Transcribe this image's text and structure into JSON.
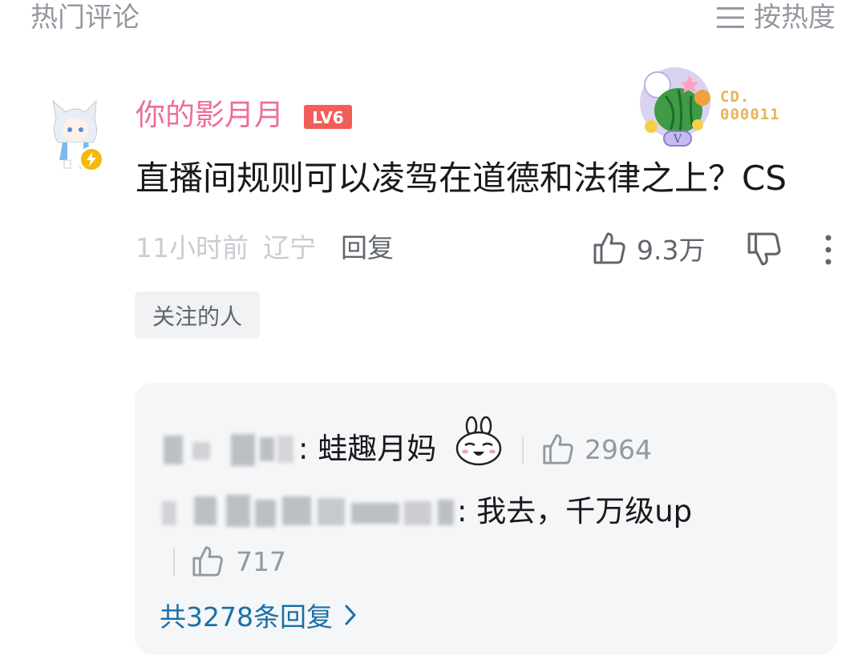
{
  "header": {
    "section_title": "热门评论",
    "sort_label": "按热度"
  },
  "comment": {
    "username": "你的影月月",
    "level": "LV6",
    "fan_badge_code_line1": "CD.",
    "fan_badge_code_line2": "000011",
    "fan_badge_letter": "V",
    "text": "直播间规则可以凌驾在道德和法律之上？CS",
    "time": "11小时前",
    "location": "辽宁",
    "reply_label": "回复",
    "like_count": "9.3万",
    "tag": "关注的人"
  },
  "replies": [
    {
      "text": ": 蛙趣月妈",
      "like_count": "2964"
    },
    {
      "text": ": 我去，千万级up",
      "like_count": "717"
    }
  ],
  "replies_total_label": "共3278条回复",
  "colors": {
    "username": "#ee6f95",
    "level_badge": "#f25d59",
    "link": "#1a6fa8",
    "muted": "#9499a0",
    "reply_bg": "#f5f6f7"
  }
}
